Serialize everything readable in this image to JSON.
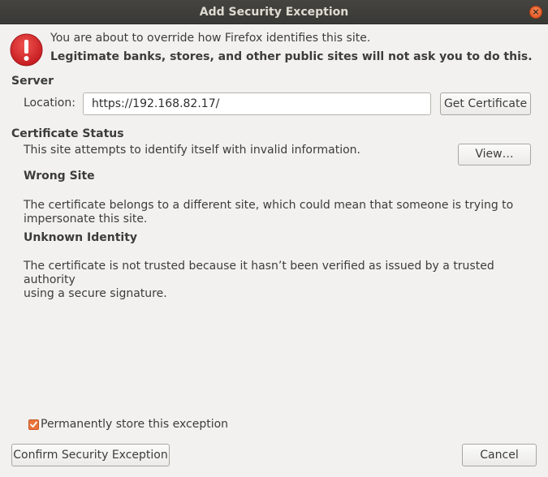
{
  "window": {
    "title": "Add Security Exception",
    "close_glyph": "×"
  },
  "warning": {
    "icon": "warning-icon",
    "line1": "You are about to override how Firefox identifies this site.",
    "line2": "Legitimate banks, stores, and other public sites will not ask you to do this."
  },
  "server": {
    "heading": "Server",
    "location_label": "Location:",
    "location_value": "https://192.168.82.17/",
    "get_certificate_label": "Get Certificate"
  },
  "certificate_status": {
    "heading": "Certificate Status",
    "summary": "This site attempts to identify itself with invalid information.",
    "view_label": "View…",
    "wrong_site_heading": "Wrong Site",
    "wrong_site_line1": "The certificate belongs to a different site, which could mean that someone is trying to",
    "wrong_site_line2": "impersonate this site.",
    "unknown_identity_heading": "Unknown Identity",
    "unknown_identity_line1": "The certificate is not trusted because it hasn’t been verified as issued by a trusted authority",
    "unknown_identity_line2": "using a secure signature."
  },
  "footer": {
    "permanent_label": "Permanently store this exception",
    "permanent_checked": true,
    "confirm_label": "Confirm Security Exception",
    "cancel_label": "Cancel"
  },
  "colors": {
    "accent": "#e9743b",
    "warning_red": "#d9252b",
    "titlebar": "#3e3d39"
  }
}
